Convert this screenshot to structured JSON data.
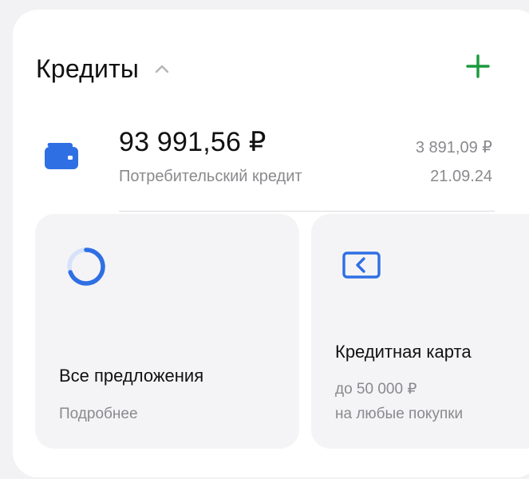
{
  "section": {
    "title": "Кредиты",
    "collapse_icon": "chevron-up-icon",
    "add_icon": "plus-icon",
    "add_color": "#1a9a3c"
  },
  "loan": {
    "icon": "wallet-icon",
    "icon_color": "#2f6fe4",
    "amount": "93 991,56 ₽",
    "name": "Потребительский кредит",
    "payment": "3 891,09 ₽",
    "date": "21.09.24"
  },
  "cards": {
    "offers": {
      "icon": "progress-ring-icon",
      "title": "Все предложения",
      "link": "Подробнее"
    },
    "credit_card": {
      "icon": "card-arrow-icon",
      "title": "Кредитная карта",
      "limit": "до 50 000 ₽",
      "purpose": "на любые покупки"
    }
  }
}
